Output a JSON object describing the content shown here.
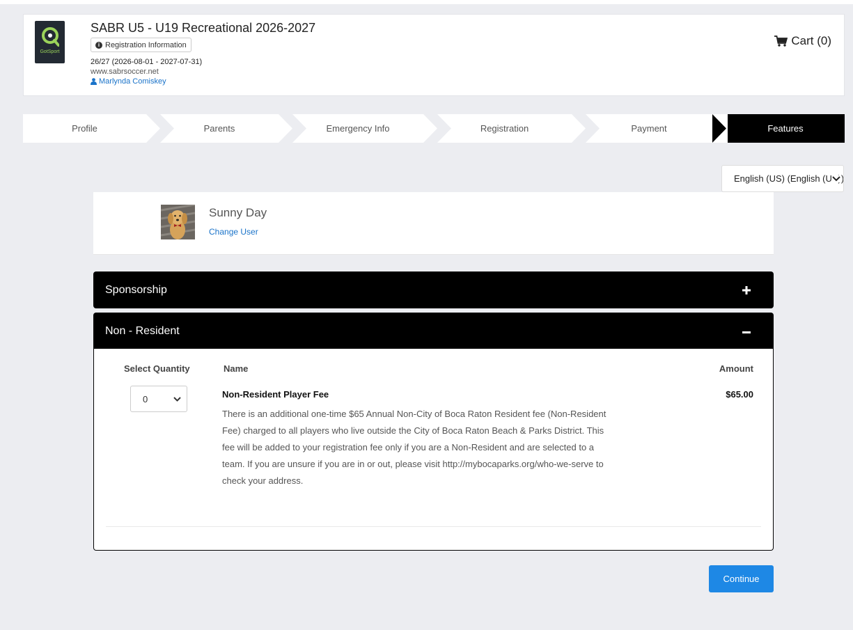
{
  "header": {
    "logo_text": "GotSport",
    "event_title": "SABR U5 - U19 Recreational 2026-2027",
    "registration_info_label": "Registration Information",
    "season": "26/27 (2026-08-01 - 2027-07-31)",
    "website": "www.sabrsoccer.net",
    "user_name": "Marlynda Comiskey",
    "cart_label": "Cart (0)"
  },
  "steps": [
    {
      "label": "Profile",
      "active": false
    },
    {
      "label": "Parents",
      "active": false
    },
    {
      "label": "Emergency Info",
      "active": false
    },
    {
      "label": "Registration",
      "active": false
    },
    {
      "label": "Payment",
      "active": false
    },
    {
      "label": "Features",
      "active": true
    }
  ],
  "language": {
    "selected": "English (US) (English (US))"
  },
  "player": {
    "name": "Sunny Day",
    "change_user_label": "Change User"
  },
  "panels": {
    "sponsorship": {
      "title": "Sponsorship",
      "icon": "plus-icon"
    },
    "non_resident": {
      "title": "Non - Resident",
      "icon": "minus-icon",
      "columns": {
        "quantity": "Select Quantity",
        "name": "Name",
        "amount": "Amount"
      },
      "items": [
        {
          "quantity": "0",
          "name": "Non-Resident Player Fee",
          "amount": "$65.00",
          "description": "There is an additional one-time $65 Annual Non-City of Boca Raton Resident fee (Non-Resident Fee) charged to all players who live outside the City of Boca Raton Beach & Parks District. This fee will be added to your registration fee only if you are a Non-Resident and are selected to a team. If you are unsure if you are in or out, please visit http://mybocaparks.org/who-we-serve to check your address."
        }
      ]
    }
  },
  "continue_label": "Continue",
  "colors": {
    "accent": "#1e88e5",
    "panel_header": "#000000",
    "link": "#1a73c9",
    "background": "#ecedf1"
  }
}
